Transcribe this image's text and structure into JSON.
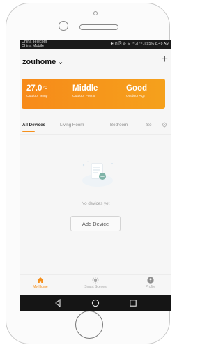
{
  "status_bar": {
    "carrier_line1": "China Telecom",
    "carrier_line2": "China Mobile",
    "indicators": "✱ ⊓ ⎘ ⊚ ≋ ⁴ᴳ.ıl ⁴ᴳ.ıl 95%",
    "time": "8:49 AM"
  },
  "header": {
    "home_name": "zouhome",
    "home_chevron": "⌄",
    "add_symbol": "+"
  },
  "weather": {
    "temp_value": "27.0",
    "temp_unit": "°C",
    "temp_label": "Outdoor Temp",
    "pm25_value": "Middle",
    "pm25_label": "Outdoor PM2.5",
    "aqi_value": "Good",
    "aqi_label": "Outdoor AQI",
    "gradient_start": "#f78a1a",
    "gradient_end": "#f5a11c"
  },
  "tabs": [
    {
      "label": "All Devices",
      "active": true
    },
    {
      "label": "Living Room",
      "active": false
    },
    {
      "label": "Bedroom",
      "active": false
    },
    {
      "label": "Se",
      "active": false
    }
  ],
  "empty_state": {
    "message": "No devices yet",
    "button_label": "Add Device"
  },
  "bottom_nav": [
    {
      "label": "My Home",
      "icon": "home-icon",
      "active": true
    },
    {
      "label": "Smart Scenes",
      "icon": "sun-icon",
      "active": false
    },
    {
      "label": "Profile",
      "icon": "profile-icon",
      "active": false
    }
  ],
  "colors": {
    "accent": "#f5901d",
    "inactive": "#a8a8a8"
  }
}
